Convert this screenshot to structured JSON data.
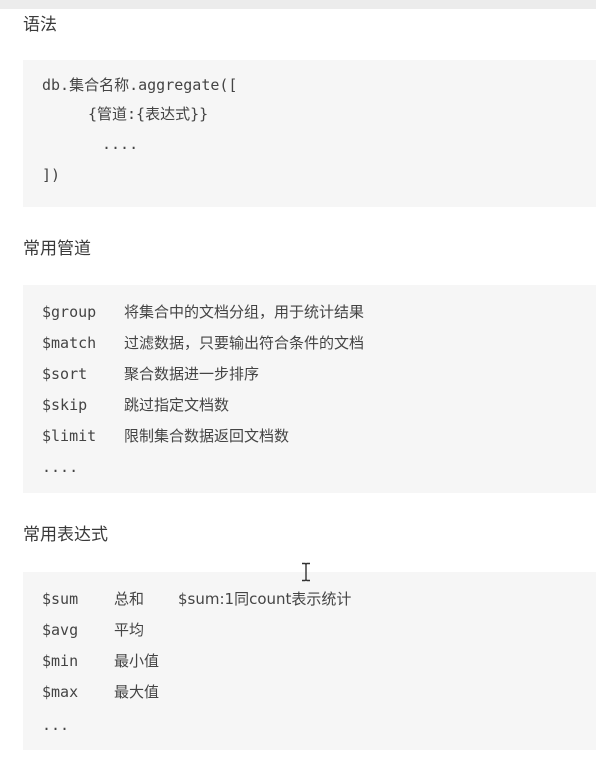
{
  "syntax": {
    "heading": "语法",
    "lines": [
      "db.集合名称.aggregate([",
      "{管道:{表达式}}",
      "....",
      "])"
    ]
  },
  "pipelines": {
    "heading": "常用管道",
    "rows": [
      {
        "op": "$group",
        "desc": "将集合中的文档分组，用于统计结果"
      },
      {
        "op": "$match",
        "desc": "过滤数据，只要输出符合条件的文档"
      },
      {
        "op": "$sort",
        "desc": "聚合数据进一步排序"
      },
      {
        "op": "$skip",
        "desc": "跳过指定文档数"
      },
      {
        "op": "$limit",
        "desc": "限制集合数据返回文档数"
      }
    ],
    "ellipsis": "...."
  },
  "expressions": {
    "heading": "常用表达式",
    "rows": [
      {
        "op": "$sum",
        "desc": "总和",
        "extra": "$sum:1同count表示统计"
      },
      {
        "op": "$avg",
        "desc": "平均"
      },
      {
        "op": "$min",
        "desc": "最小值"
      },
      {
        "op": "$max",
        "desc": "最大值"
      }
    ],
    "ellipsis": "..."
  },
  "cursor": {
    "icon": "text-cursor-icon"
  }
}
